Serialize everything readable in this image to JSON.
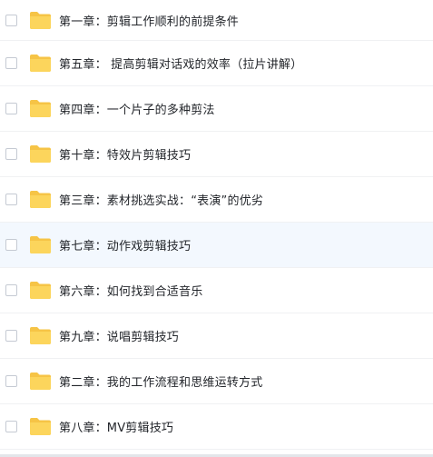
{
  "folder_color": "#fcd55c",
  "folder_tab_color": "#f6c446",
  "hover_row_color": "#f3f8fe",
  "items": [
    {
      "name": "第一章：剪辑工作顺利的前提条件",
      "icon": "folder-icon"
    },
    {
      "name": "第五章： 提高剪辑对话戏的效率（拉片讲解）",
      "icon": "folder-icon"
    },
    {
      "name": "第四章：一个片子的多种剪法",
      "icon": "folder-icon"
    },
    {
      "name": "第十章：特效片剪辑技巧",
      "icon": "folder-icon"
    },
    {
      "name": "第三章：素材挑选实战：“表演”的优劣",
      "icon": "folder-icon"
    },
    {
      "name": "第七章：动作戏剪辑技巧",
      "icon": "folder-icon",
      "hover": true
    },
    {
      "name": "第六章：如何找到合适音乐",
      "icon": "folder-icon"
    },
    {
      "name": "第九章：说唱剪辑技巧",
      "icon": "folder-icon"
    },
    {
      "name": "第二章：我的工作流程和思维运转方式",
      "icon": "folder-icon"
    },
    {
      "name": "第八章：MV剪辑技巧",
      "icon": "folder-icon"
    }
  ]
}
